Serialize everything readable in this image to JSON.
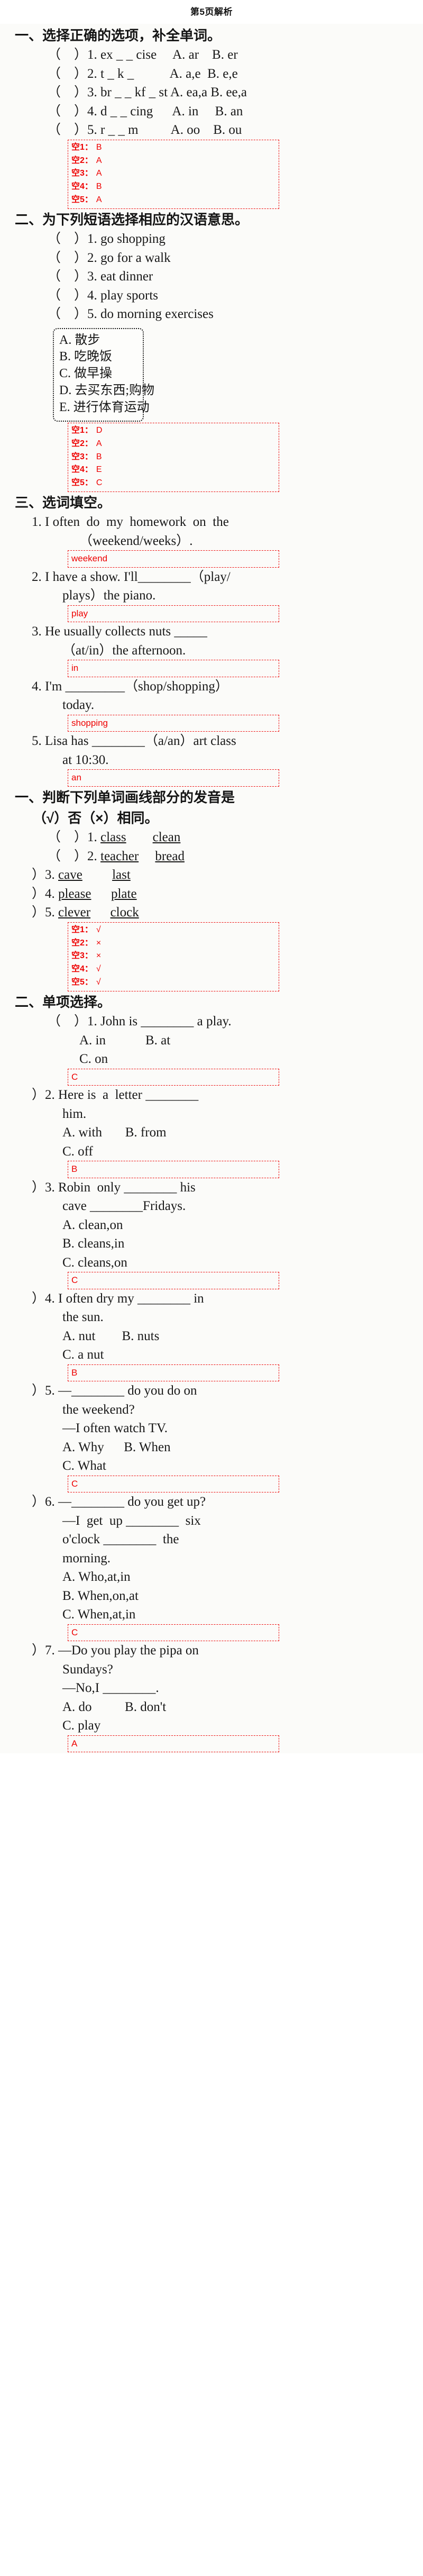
{
  "title": "第5页解析",
  "colors": {
    "answer_red": "#ee0000",
    "text_black": "#181818"
  },
  "sections": [
    {
      "id": "s1",
      "heading": "一、选择正确的选项，补全单词。",
      "items": [
        "（    ）1. ex _ _ cise     A. ar    B. er",
        "（    ）2. t _ k _           A. a,e  B. e,e",
        "（    ）3. br _ _ kf _ st A. ea,a B. ee,a",
        "（    ）4. d _ _ cing      A. in     B. an",
        "（    ）5. r _ _ m          A. oo    B. ou"
      ],
      "answers": [
        {
          "label": "空1：",
          "value": "B"
        },
        {
          "label": "空2：",
          "value": "A"
        },
        {
          "label": "空3：",
          "value": "A"
        },
        {
          "label": "空4：",
          "value": "B"
        },
        {
          "label": "空5：",
          "value": "A"
        }
      ]
    },
    {
      "id": "s2",
      "heading": "二、为下列短语选择相应的汉语意思。",
      "items": [
        "（    ）1. go shopping",
        "（    ）2. go for a walk",
        "（    ）3. eat dinner",
        "（    ）4. play sports",
        "（    ）5. do morning exercises"
      ],
      "pool": [
        "A. 散步",
        "B. 吃晚饭",
        "C. 做早操",
        "D. 去买东西;购物",
        "E. 进行体育运动"
      ],
      "answers": [
        {
          "label": "空1：",
          "value": "D"
        },
        {
          "label": "空2：",
          "value": "A"
        },
        {
          "label": "空3：",
          "value": "B"
        },
        {
          "label": "空4：",
          "value": "E"
        },
        {
          "label": "空5：",
          "value": "C"
        }
      ]
    },
    {
      "id": "s3",
      "heading": "三、选词填空。",
      "questions": [
        {
          "lines": [
            "1. I often  do  my  homework  on  the",
            "（weekend/weeks）."
          ],
          "answer": "weekend"
        },
        {
          "lines": [
            "2. I have a show. I'll________（play/",
            "plays）the piano."
          ],
          "answer": "play"
        },
        {
          "lines": [
            "3. He usually collects nuts _____",
            "（at/in）the afternoon."
          ],
          "answer": "in"
        },
        {
          "lines": [
            "4. I'm _________（shop/shopping）",
            "today."
          ],
          "answer": "shopping"
        },
        {
          "lines": [
            "5. Lisa has ________（a/an）art class",
            "at 10:30."
          ],
          "answer": "an"
        }
      ]
    },
    {
      "id": "s4",
      "heading": "一、判断下列单词画线部分的发音是（√）否（×）相同。",
      "heading_line1": "一、判断下列单词画线部分的发音是",
      "heading_line2": "（√）否（×）相同。",
      "items": [
        {
          "num": "（    ）1.",
          "w1": "class",
          "w1u": "c",
          "w2": "clean",
          "w2u": "c"
        },
        {
          "num": "（    ）2.",
          "w1": "teacher",
          "w1u": "t",
          "w2": "bread",
          "w2u": "ea"
        },
        {
          "num": "）3.",
          "w1": "cave",
          "w1u": "a",
          "w2": "last",
          "w2u": "a"
        },
        {
          "num": "）4.",
          "w1": "please",
          "w1u": "pl",
          "w2": "plate",
          "w2u": "pl"
        },
        {
          "num": "）5.",
          "w1": "clever",
          "w1u": "c",
          "w2": "clock",
          "w2u": "c"
        }
      ],
      "answers": [
        {
          "label": "空1：",
          "value": "√"
        },
        {
          "label": "空2：",
          "value": "×"
        },
        {
          "label": "空3：",
          "value": "×"
        },
        {
          "label": "空4：",
          "value": "√"
        },
        {
          "label": "空5：",
          "value": "√"
        }
      ]
    },
    {
      "id": "s5",
      "heading": "二、单项选择。",
      "questions": [
        {
          "stem": [
            "（    ）1. John is ________ a play."
          ],
          "opts": [
            "A. in            B. at",
            "C. on"
          ],
          "answer": "C"
        },
        {
          "stem": [
            "）2. Here is  a  letter ________",
            "him."
          ],
          "opts": [
            "A. with       B. from",
            "C. off"
          ],
          "answer": "B"
        },
        {
          "stem": [
            "）3. Robin  only ________ his",
            "cave ________Fridays."
          ],
          "opts": [
            "A. clean,on",
            "B. cleans,in",
            "C. cleans,on"
          ],
          "answer": "C"
        },
        {
          "stem": [
            "）4. I often dry my ________ in",
            "the sun."
          ],
          "opts": [
            "A. nut        B. nuts",
            "C. a nut"
          ],
          "answer": "B"
        },
        {
          "stem": [
            "）5. —________ do you do on",
            "the weekend?",
            "—I often watch TV."
          ],
          "opts": [
            "A. Why      B. When",
            "C. What"
          ],
          "answer": "C"
        },
        {
          "stem": [
            "）6. —________ do you get up?",
            "—I  get  up ________  six",
            "o'clock ________  the",
            "morning."
          ],
          "opts": [
            "A. Who,at,in",
            "B. When,on,at",
            "C. When,at,in"
          ],
          "answer": "C"
        },
        {
          "stem": [
            "）7. —Do you play the pipa on",
            "Sundays?",
            "—No,I ________."
          ],
          "opts": [
            "A. do          B. don't",
            "C. play"
          ],
          "answer": "A"
        }
      ]
    }
  ]
}
